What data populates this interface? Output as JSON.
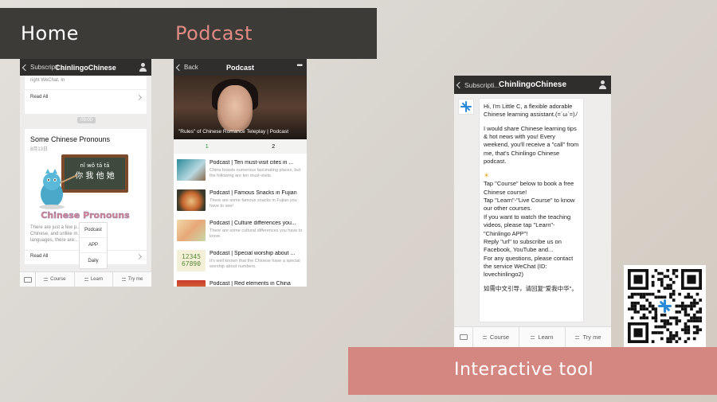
{
  "header": {
    "home_label": "Home",
    "podcast_label": "Podcast"
  },
  "phone1": {
    "back": "Subscripti...",
    "title": "ChinlingoChinese",
    "card1_text": "right WeChat. In",
    "card1_readall": "Read All",
    "time": "09:00",
    "card2_title": "Some Chinese Pronouns",
    "card2_date": "8月13日",
    "board_pinyin": "nǐ  wǒ  tā  tā",
    "board_hanzi": "你 我 他 她",
    "banner": "Chinese Pronouns",
    "card2_desc": "There are just a few p... ...andard Chinese, and unlike m... ...ern languages, there are...",
    "card2_readall": "Read All",
    "popup": [
      "Podcast",
      "APP",
      "Daily"
    ],
    "menu": [
      "Course",
      "Learn",
      "Try me"
    ]
  },
  "phone2": {
    "back": "Back",
    "title": "Podcast",
    "more": "•••",
    "hero_caption": "\"Rules\" of Chinese Romance Teleplay | Podcast",
    "tabs": [
      "1",
      "2"
    ],
    "items": [
      {
        "title": "Podcast | Ten must-visit cites in ...",
        "desc": "China boasts numerous fascinating places, but the following are ten must-visits."
      },
      {
        "title": "Podcast | Famous Snacks in Fujian",
        "desc": "There are some famous snacks in Fujian you have to see!"
      },
      {
        "title": "Podcast | Culture differences you...",
        "desc": "There are some cultural differences you have to know."
      },
      {
        "title": "Podcast | Special worship about ...",
        "desc": "It's well known that the Chinese have a special worship about numbers."
      },
      {
        "title": "Podcast | Red elements in China",
        "desc": ""
      }
    ],
    "num_thumb": "12345 67890"
  },
  "phone3": {
    "back": "Subscripti...",
    "title": "ChinlingoChinese",
    "msg1": "Hi, I'm Little C, a flexible adorable Chinese learning assistant.(=´ω`=)ﾉ",
    "msg2": "I would share Chinese learning tips & hot news with you! Every weekend, you'll receive a \"call\" from me, that's Chinlingo Chinese podcast.",
    "msg3_sun": "☀",
    "msg3": "Tap \"Course\" below to book a free Chinese course!",
    "msg4": "Tap \"Learn\"-\"Live Course\" to know our other courses.",
    "msg5": "If you want to watch the teaching videos, please tap \"Learn\"-\"Chinlingo APP\"!",
    "msg6": "Reply \"url\" to subscribe us on Facebook, YouTube and...",
    "msg7": "For any questions, please contact the service WeChat (ID: lovechinlingo2)",
    "msg8": "如需中文引导，请回复\"爱我中华\"。",
    "menu": [
      "Course",
      "Learn",
      "Try me"
    ]
  },
  "interactive_label": "Interactive tool",
  "colors": {
    "header_band": "#3d3b37",
    "accent_pink": "#d48780",
    "podcast_text": "#e28b84",
    "wechat_bar": "#2f2e2c",
    "tab_green": "#2a9a3a"
  }
}
